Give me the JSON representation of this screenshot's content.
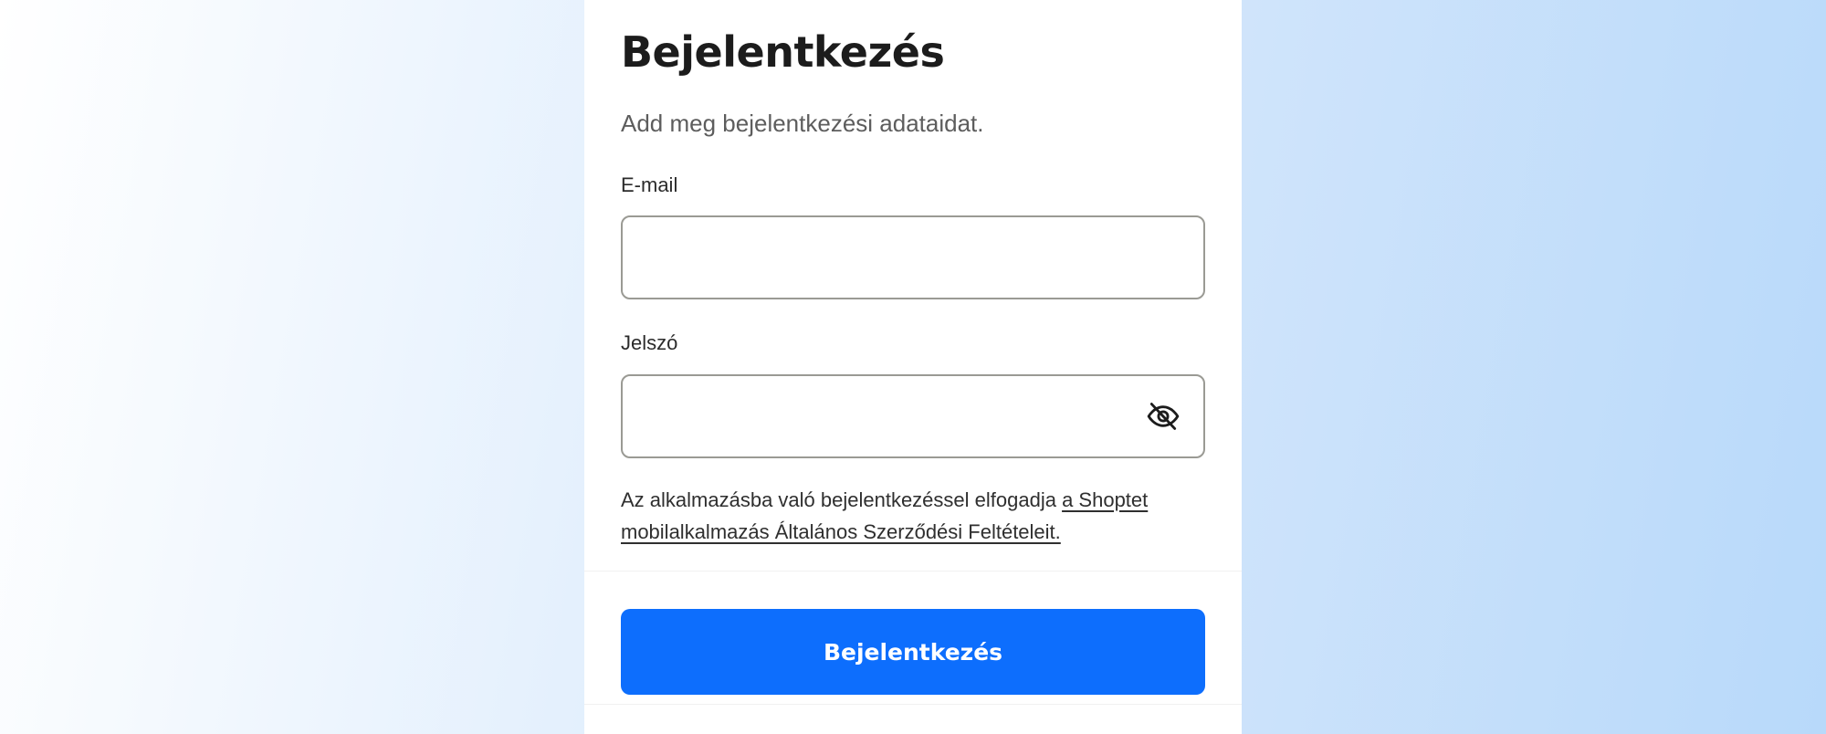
{
  "login": {
    "title": "Bejelentkezés",
    "subtitle": "Add meg bejelentkezési adataidat.",
    "email": {
      "label": "E-mail",
      "value": "",
      "placeholder": ""
    },
    "password": {
      "label": "Jelszó",
      "value": "",
      "placeholder": "",
      "toggle_icon": "eye-off-icon"
    },
    "terms": {
      "text": "Az alkalmazásba való bejelentkezéssel elfogadja ",
      "link_text": "a Shoptet mobilalkalmazás Általános Szerződési Feltételeit."
    },
    "submit_label": "Bejelentkezés"
  },
  "colors": {
    "primary": "#0d6efd",
    "background_start": "#ffffff",
    "background_end": "#b8d9fa",
    "text": "#1c1c1c",
    "muted_text": "#5d5d5d",
    "input_border": "#9a9a94"
  }
}
